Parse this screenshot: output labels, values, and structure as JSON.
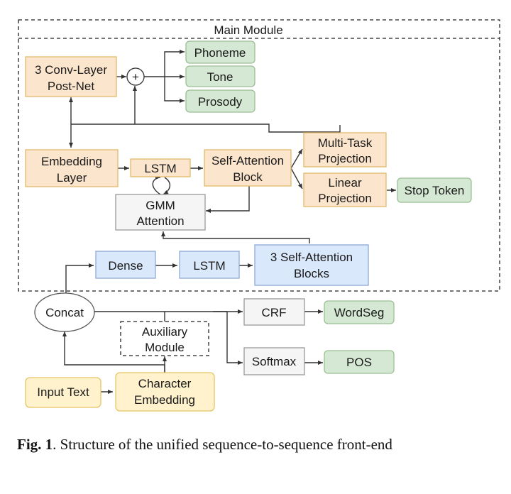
{
  "main_module": {
    "title": "Main Module"
  },
  "nodes": {
    "postnet": {
      "line1": "3 Conv-Layer",
      "line2": "Post-Net"
    },
    "plus": {
      "symbol": "+"
    },
    "phoneme": {
      "label": "Phoneme"
    },
    "tone": {
      "label": "Tone"
    },
    "prosody": {
      "label": "Prosody"
    },
    "embedding": {
      "line1": "Embedding",
      "line2": "Layer"
    },
    "lstm_main": {
      "label": "LSTM"
    },
    "self_attn": {
      "line1": "Self-Attention",
      "line2": "Block"
    },
    "multitask": {
      "line1": "Multi-Task",
      "line2": "Projection"
    },
    "linear": {
      "line1": "Linear",
      "line2": "Projection"
    },
    "stop": {
      "label": "Stop Token"
    },
    "gmm": {
      "line1": "GMM",
      "line2": "Attention"
    },
    "dense": {
      "label": "Dense"
    },
    "lstm_enc": {
      "label": "LSTM"
    },
    "sa_blocks": {
      "line1": "3 Self-Attention",
      "line2": "Blocks"
    },
    "concat": {
      "label": "Concat"
    },
    "aux": {
      "line1": "Auxiliary",
      "line2": "Module"
    },
    "crf": {
      "label": "CRF"
    },
    "wordseg": {
      "label": "WordSeg"
    },
    "softmax": {
      "label": "Softmax"
    },
    "pos": {
      "label": "POS"
    },
    "input": {
      "label": "Input Text"
    },
    "char_emb": {
      "line1": "Character",
      "line2": "Embedding"
    }
  },
  "colors": {
    "orange_fill": "#fce5cd",
    "orange_stroke": "#e0b96a",
    "green_fill": "#d5e8d4",
    "green_stroke": "#9bbf94",
    "blue_fill": "#dae8fc",
    "blue_stroke": "#8fa9d6",
    "gray_fill": "#f5f5f5",
    "gray_stroke": "#888888",
    "yellow_fill": "#fff2cc",
    "yellow_stroke": "#e6c566"
  },
  "caption": {
    "label": "Fig. 1",
    "text": ".  Structure of the unified sequence-to-sequence front-end"
  }
}
